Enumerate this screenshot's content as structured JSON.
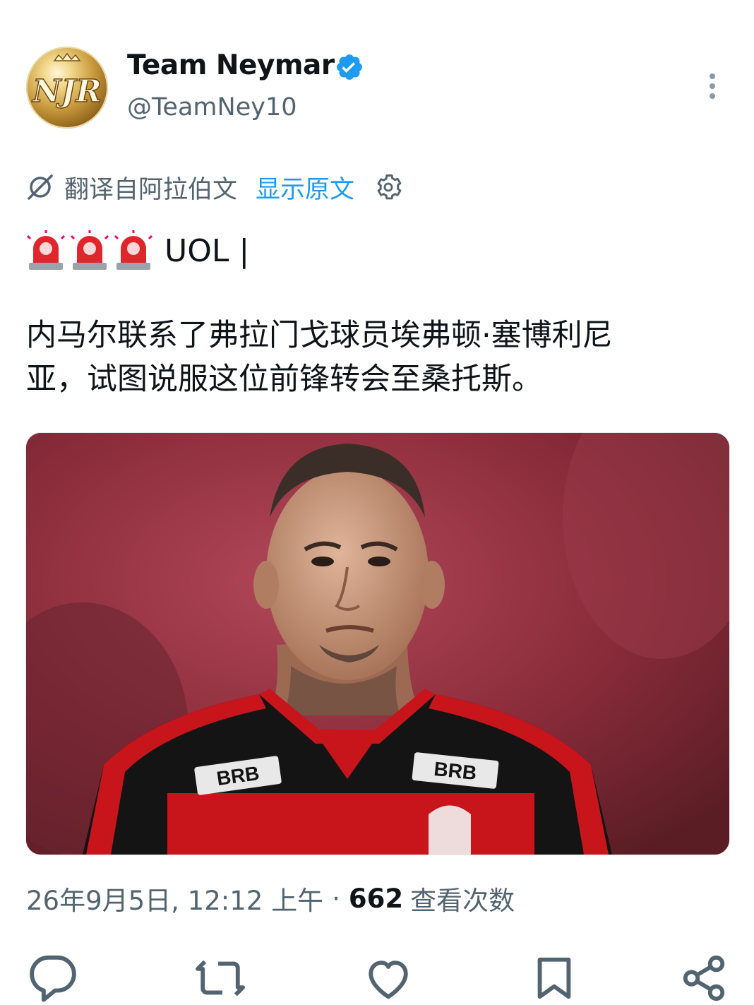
{
  "header": {
    "display_name": "Team Neymar",
    "handle": "@TeamNey10",
    "verified": true,
    "avatar_icon": "team-neymar-crest-logo",
    "avatar_logo_text": "NJR",
    "more_icon": "more-vertical-icon"
  },
  "translation": {
    "icon": "translate-icon",
    "label": "翻译自阿拉伯文",
    "show_original": "显示原文",
    "settings_icon": "gear-icon"
  },
  "tweet": {
    "emoji": [
      "🚨",
      "🚨",
      "🚨"
    ],
    "source": "UOL |",
    "body_lines": [
      "内马尔联系了弗拉门戈球员埃弗顿·塞博利尼",
      "亚，试图说服这位前锋转会至桑托斯。"
    ]
  },
  "media": {
    "shirt_sponsor_left": "BRB",
    "shirt_sponsor_right": "BRB"
  },
  "meta": {
    "timestamp": "26年9月5日, 12:12 上午",
    "separator": "·",
    "views_count": "662",
    "views_label": "查看次数"
  },
  "actions": [
    {
      "name": "reply",
      "icon": "reply-icon"
    },
    {
      "name": "retweet",
      "icon": "retweet-icon"
    },
    {
      "name": "like",
      "icon": "like-icon"
    },
    {
      "name": "bookmark",
      "icon": "bookmark-icon"
    },
    {
      "name": "share",
      "icon": "share-icon"
    }
  ],
  "colors": {
    "text_primary": "#0f1419",
    "text_secondary": "#536471",
    "link": "#1d9bf0",
    "verified_badge": "#1d9bf0",
    "jersey_red": "#c8141b",
    "jersey_black": "#141414"
  }
}
